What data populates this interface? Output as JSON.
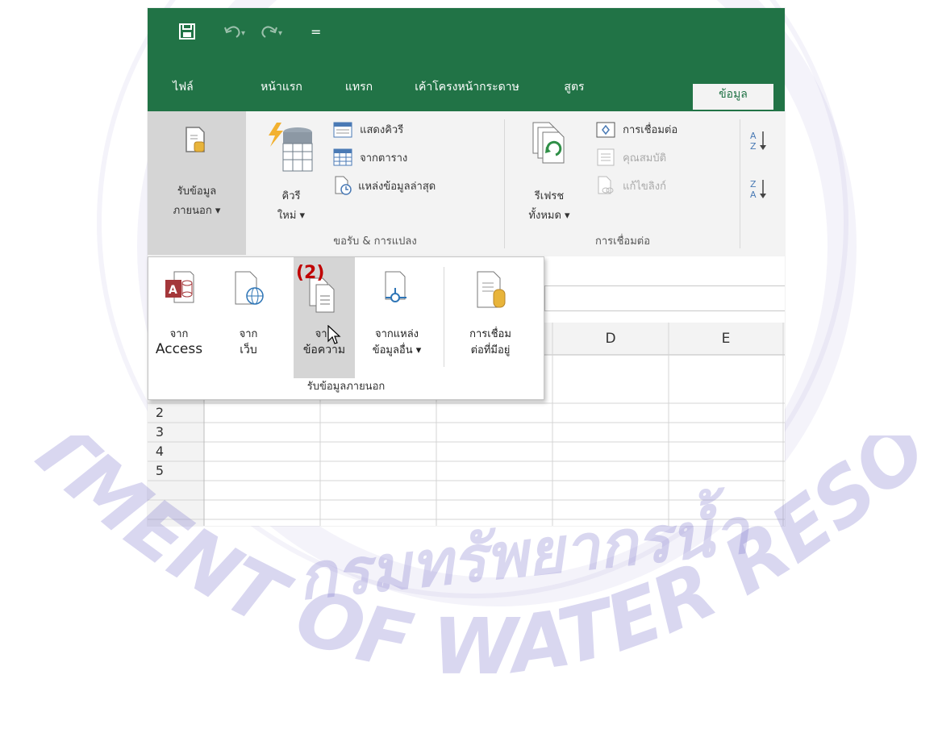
{
  "watermark": {
    "arc_text": "กรมทรัพยากรน้ำ",
    "bottom_text": "DEPARTMENT OF WATER RESOURCES"
  },
  "qat": {
    "save_icon": "save-icon",
    "undo_icon": "undo-icon",
    "redo_icon": "redo-icon",
    "customize": "="
  },
  "tabs": [
    "ไฟล์",
    "หน้าแรก",
    "แทรก",
    "เค้าโครงหน้ากระดาษ",
    "สูตร",
    "ข้อมูล"
  ],
  "active_tab_index": 5,
  "ribbon": {
    "get_external": {
      "line1": "รับข้อมูล",
      "line2": "ภายนอก ▾"
    },
    "new_query": {
      "line1": "คิวรี",
      "line2": "ใหม่ ▾"
    },
    "show_queries": "แสดงคิวรี",
    "from_table": "จากตาราง",
    "recent_sources": "แหล่งข้อมูลล่าสุด",
    "group_get_transform": "ขอรับ & การแปลง",
    "refresh_all": {
      "line1": "รีเฟรช",
      "line2": "ทั้งหมด ▾"
    },
    "connections": "การเชื่อมต่อ",
    "properties": "คุณสมบัติ",
    "edit_links": "แก้ไขลิงก์",
    "group_connections": "การเชื่อมต่อ",
    "sort_az": "A↓Z",
    "sort_za": "Z↓A"
  },
  "dropdown": {
    "items": [
      {
        "line1": "จาก",
        "line2": "Access",
        "icon": "access-icon"
      },
      {
        "line1": "จาก",
        "line2": "เว็บ",
        "icon": "web-icon"
      },
      {
        "line1": "จาก",
        "line2": "ข้อความ",
        "icon": "text-file-icon"
      },
      {
        "line1": "จากแหล่ง",
        "line2": "ข้อมูลอื่น ▾",
        "icon": "other-sources-icon"
      },
      {
        "line1": "การเชื่อม",
        "line2": "ต่อที่มีอยู่",
        "icon": "existing-connections-icon"
      }
    ],
    "group_label": "รับข้อมูลภายนอก"
  },
  "callout": "(2)",
  "grid": {
    "columns": [
      "D",
      "E"
    ],
    "rows": [
      "2",
      "3",
      "4",
      "5"
    ]
  },
  "colors": {
    "excel_green": "#217346",
    "callout_red": "#c00000"
  }
}
